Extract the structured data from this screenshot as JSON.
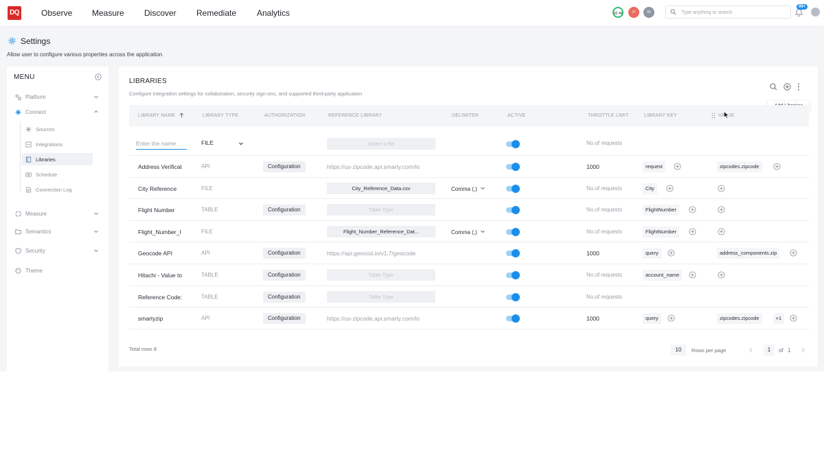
{
  "nav": {
    "logo": "DQ",
    "items": [
      "Observe",
      "Measure",
      "Discover",
      "Remediate",
      "Analytics"
    ],
    "avatars": [
      {
        "text": "92.46",
        "color": "#ffffff",
        "ring": "#2fbf71"
      },
      {
        "text": "37",
        "color": "#e86a5e"
      },
      {
        "text": "65",
        "color": "#8e95a3"
      }
    ],
    "search_placeholder": "Type anything to search",
    "notification_count": "99+"
  },
  "header": {
    "title": "Settings",
    "subtitle": "Allow user to configure various properties across the application"
  },
  "sidebar": {
    "title": "MENU",
    "items": [
      {
        "label": "Platform",
        "icon": "platform-icon"
      },
      {
        "label": "Connect",
        "icon": "connect-icon"
      },
      {
        "label": "Measure",
        "icon": "measure-icon"
      },
      {
        "label": "Semantics",
        "icon": "semantics-icon"
      },
      {
        "label": "Security",
        "icon": "security-icon"
      },
      {
        "label": "Theme",
        "icon": "theme-icon"
      }
    ],
    "connect_sub": [
      "Sources",
      "Integrations",
      "Libraries",
      "Schedule",
      "Connection Log"
    ]
  },
  "card": {
    "title": "LIBRARIES",
    "subtitle": "Configure integration settings for collaboration, security sign-ons, and supported third-party application",
    "tooltip": "Add Libraries"
  },
  "table": {
    "headers": [
      "LIBRARY NAME",
      "LIBRARY TYPE",
      "AUTHORIZATION",
      "REFERENCE LIBRARY",
      "DELIMITER",
      "ACTIVE",
      "THROTTLE LIMIT",
      "LIBRARY KEY",
      "VALUE"
    ],
    "new_row": {
      "name_placeholder": "Enter the name",
      "type": "FILE",
      "reference_placeholder": "Select a file",
      "throttle": "No.of requests"
    },
    "rows": [
      {
        "name": "Address Verificat",
        "type": "API",
        "auth": "Configuration",
        "ref": "https://us-zipcode.api.smarty.com/lo",
        "ref_kind": "url",
        "delim": "",
        "throttle": "1000",
        "key": "request",
        "value": "zipcodes.zipcode",
        "value_extra": ""
      },
      {
        "name": "City Reference",
        "type": "FILE",
        "auth": "",
        "ref": "City_Reference_Data.csv",
        "ref_kind": "file",
        "delim": "Comma (,)",
        "throttle": "No.of requests",
        "key": "City",
        "value": "",
        "value_extra": ""
      },
      {
        "name": "Flight Number",
        "type": "TABLE",
        "auth": "Configuration",
        "ref": "Table Type",
        "ref_kind": "placeholder",
        "delim": "",
        "throttle": "No.of requests",
        "key": "FlightNumber",
        "value": "",
        "value_extra": ""
      },
      {
        "name": "Flight_Number_I",
        "type": "FILE",
        "auth": "",
        "ref": "Flight_Number_Reference_Dat...",
        "ref_kind": "file",
        "delim": "Comma (,)",
        "throttle": "No.of requests",
        "key": "FlightNumber",
        "value": "",
        "value_extra": ""
      },
      {
        "name": "Geocode API",
        "type": "API",
        "auth": "Configuration",
        "ref": "https://api.geocod.io/v1.7/geocode",
        "ref_kind": "url",
        "delim": "",
        "throttle": "1000",
        "key": "query",
        "value": "address_components.zip",
        "value_extra": ""
      },
      {
        "name": "Hitachi - Value to",
        "type": "TABLE",
        "auth": "Configuration",
        "ref": "Table Type",
        "ref_kind": "placeholder",
        "delim": "",
        "throttle": "No.of requests",
        "key": "account_name",
        "value": "",
        "value_extra": ""
      },
      {
        "name": "Reference Code:",
        "type": "TABLE",
        "auth": "Configuration",
        "ref": "Table Type",
        "ref_kind": "placeholder",
        "delim": "",
        "throttle": "No.of requests",
        "key": "",
        "value": "",
        "value_extra": ""
      },
      {
        "name": "smartyzip",
        "type": "API",
        "auth": "Configuration",
        "ref": "https://us-zipcode.api.smarty.com/lo",
        "ref_kind": "url",
        "delim": "",
        "throttle": "1000",
        "key": "query",
        "value": "zipcodes.zipcode",
        "value_extra": "+1"
      }
    ]
  },
  "footer": {
    "total": "Total rows 8",
    "rows_per_page": "10",
    "rows_per_page_label": "Rows per page",
    "page": "1",
    "of_label": "of",
    "total_pages": "1"
  },
  "colors": {
    "accent": "#1b8eea",
    "logo": "#d92b2b"
  }
}
